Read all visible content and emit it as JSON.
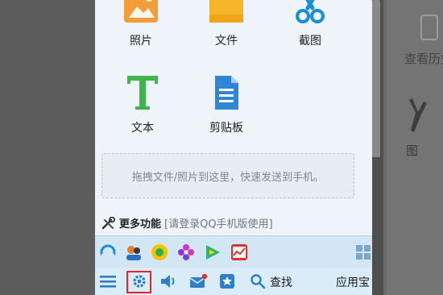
{
  "tiles": [
    {
      "label": "照片",
      "icon": "photo-icon"
    },
    {
      "label": "文件",
      "icon": "folder-icon"
    },
    {
      "label": "截图",
      "icon": "scissors-icon"
    },
    {
      "label": "文本",
      "icon": "text-icon"
    },
    {
      "label": "剪贴板",
      "icon": "clipboard-document-icon"
    }
  ],
  "drop_zone": {
    "text": "拖拽文件/照片到这里，快速发送到手机。"
  },
  "more_features": {
    "label": "更多功能",
    "hint": "[请登录QQ手机版使用]",
    "icon": "tools-icon"
  },
  "apps": [
    {
      "name": "qq-browser-icon"
    },
    {
      "name": "contacts-icon"
    },
    {
      "name": "qq-music-icon"
    },
    {
      "name": "flower-app-icon"
    },
    {
      "name": "video-player-icon"
    },
    {
      "name": "stock-app-icon"
    },
    {
      "name": "grid-apps-icon"
    }
  ],
  "toolbar": {
    "menu_icon": "menu-icon",
    "settings_icon": "gear-icon",
    "sound_icon": "speaker-icon",
    "mail_icon": "mail-icon",
    "favorite_icon": "star-icon",
    "find_icon": "search-icon",
    "find_label": "查找",
    "app_store_label": "应用宝"
  },
  "background_window": {
    "history_label": "查看历史",
    "partial_char": "图"
  },
  "colors": {
    "highlight": "#e0252b",
    "accent": "#1a8fd7",
    "text_icon": "#3fb54d"
  }
}
